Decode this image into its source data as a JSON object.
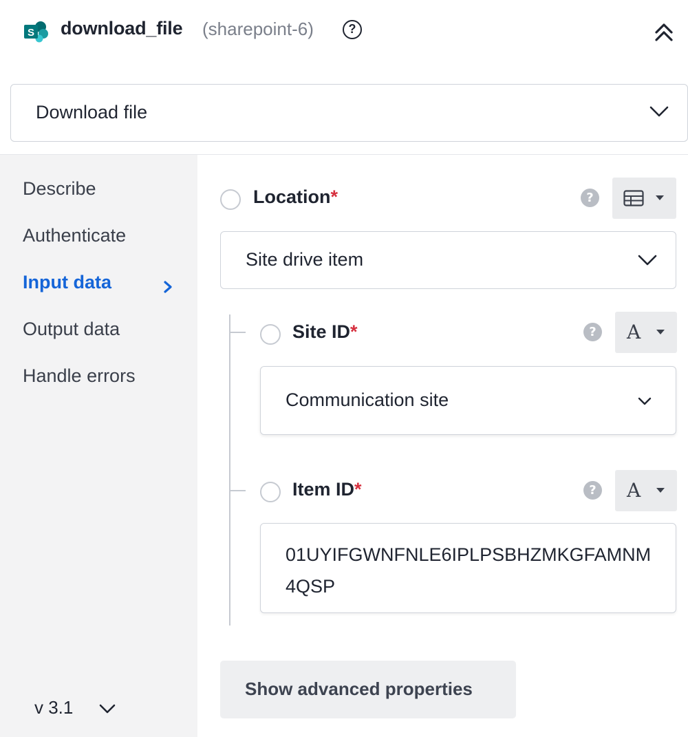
{
  "header": {
    "title": "download_file",
    "subtitle": "(sharepoint-6)",
    "help": "?",
    "logo_icon": "sharepoint-logo-icon",
    "collapse_icon": "chevrons-up-icon"
  },
  "action_select": {
    "value": "Download file"
  },
  "sidebar": {
    "items": [
      {
        "label": "Describe",
        "active": false
      },
      {
        "label": "Authenticate",
        "active": false
      },
      {
        "label": "Input data",
        "active": true
      },
      {
        "label": "Output data",
        "active": false
      },
      {
        "label": "Handle errors",
        "active": false
      }
    ],
    "version": "v 3.1"
  },
  "fields": {
    "location": {
      "label": "Location",
      "required": "*",
      "value": "Site drive item",
      "type_icon": "table-icon"
    },
    "site_id": {
      "label": "Site ID",
      "required": "*",
      "value": "Communication site",
      "type_glyph": "A"
    },
    "item_id": {
      "label": "Item ID",
      "required": "*",
      "value": "01UYIFGWNFNLE6IPLPSBHZMKGFAMNM4QSP",
      "type_glyph": "A"
    }
  },
  "advanced_button": "Show advanced properties",
  "colors": {
    "accent": "#1565d8",
    "required": "#d6303f",
    "sidebar_bg": "#f3f3f4",
    "sharepoint_brand": "#036c70"
  }
}
